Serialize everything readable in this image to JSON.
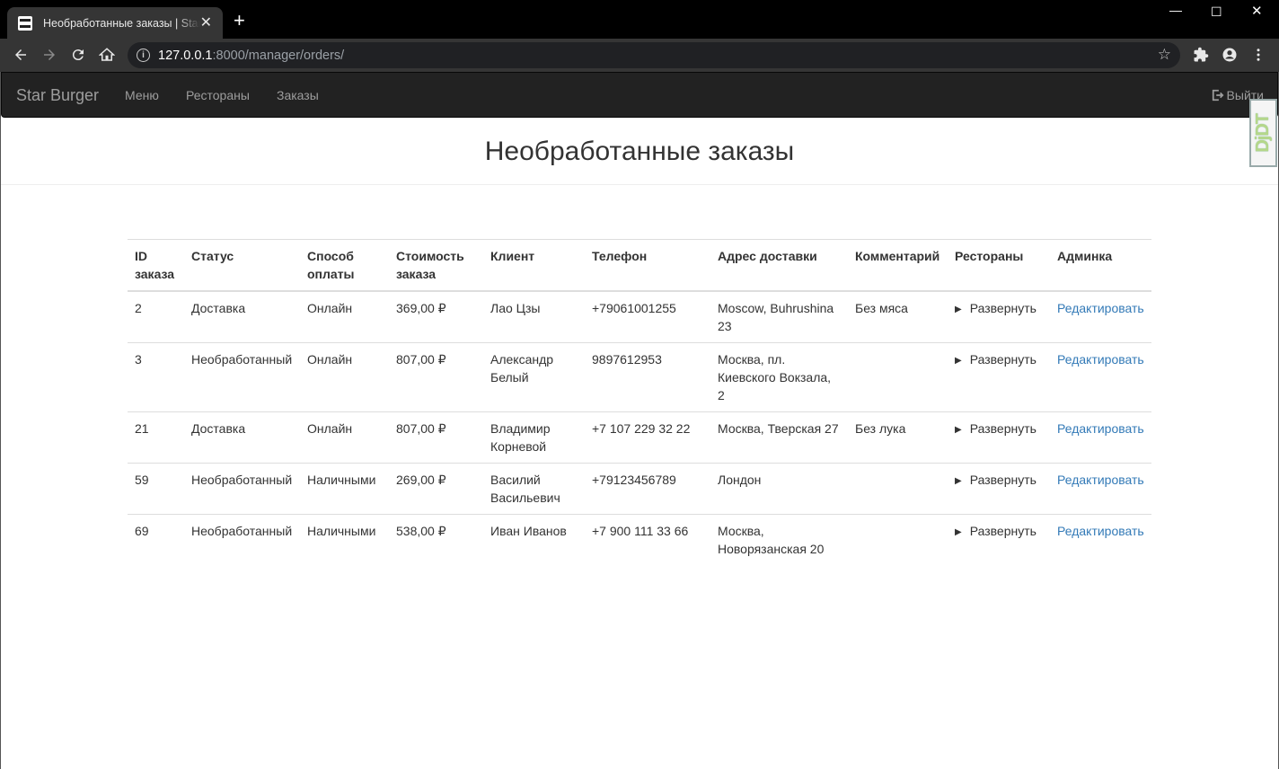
{
  "browser": {
    "tab_title": "Необработанные заказы | Star Burger",
    "url_host": "127.0.0.1",
    "url_rest": ":8000/manager/orders/"
  },
  "navbar": {
    "brand": "Star Burger",
    "links": [
      "Меню",
      "Рестораны",
      "Заказы"
    ],
    "logout": "Выйти",
    "debug_toolbar": "DjDT"
  },
  "page": {
    "title": "Необработанные заказы"
  },
  "table": {
    "headers": [
      "ID заказа",
      "Статус",
      "Способ оплаты",
      "Стоимость заказа",
      "Клиент",
      "Телефон",
      "Адрес доставки",
      "Комментарий",
      "Рестораны",
      "Админка"
    ],
    "rows": [
      {
        "id": "2",
        "status": "Доставка",
        "payment": "Онлайн",
        "cost": "369,00 ₽",
        "client": "Лао Цзы",
        "phone": "+79061001255",
        "address": "Moscow, Buhrushina 23",
        "comment": "Без мяса",
        "restaurants": "Развернуть",
        "admin": "Редактировать"
      },
      {
        "id": "3",
        "status": "Необработанный",
        "payment": "Онлайн",
        "cost": "807,00 ₽",
        "client": "Александр Белый",
        "phone": "9897612953",
        "address": "Москва, пл. Киевского Вокзала, 2",
        "comment": "",
        "restaurants": "Развернуть",
        "admin": "Редактировать"
      },
      {
        "id": "21",
        "status": "Доставка",
        "payment": "Онлайн",
        "cost": "807,00 ₽",
        "client": "Владимир Корневой",
        "phone": "+7 107 229 32 22",
        "address": "Москва, Тверская 27",
        "comment": "Без лука",
        "restaurants": "Развернуть",
        "admin": "Редактировать"
      },
      {
        "id": "59",
        "status": "Необработанный",
        "payment": "Наличными",
        "cost": "269,00 ₽",
        "client": "Василий Васильевич",
        "phone": "+79123456789",
        "address": "Лондон",
        "comment": "",
        "restaurants": "Развернуть",
        "admin": "Редактировать"
      },
      {
        "id": "69",
        "status": "Необработанный",
        "payment": "Наличными",
        "cost": "538,00 ₽",
        "client": "Иван Иванов",
        "phone": "+7 900 111 33 66",
        "address": "Москва, Новорязанская 20",
        "comment": "",
        "restaurants": "Развернуть",
        "admin": "Редактировать"
      }
    ]
  },
  "colors": {
    "navbar_bg": "#222222",
    "link": "#337ab7",
    "chrome_bg": "#353535"
  }
}
